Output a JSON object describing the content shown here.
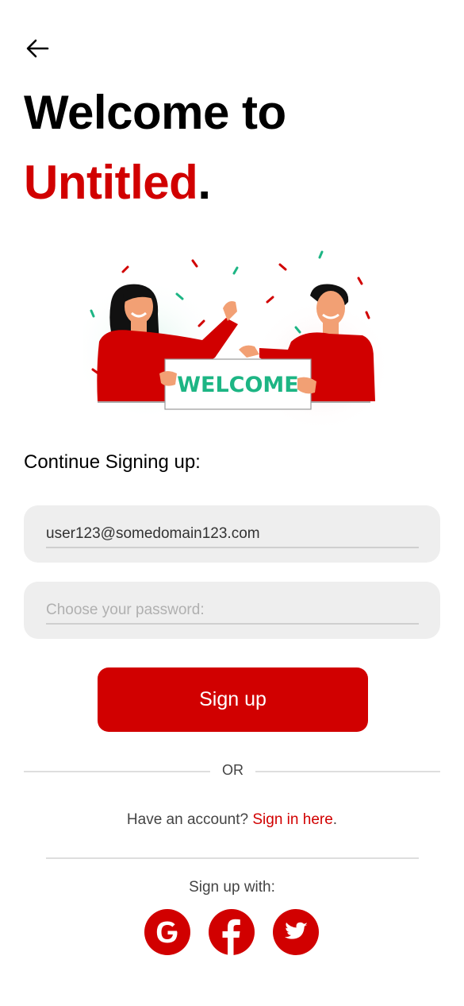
{
  "header": {
    "title_line1": "Welcome to",
    "title_brand": "Untitled",
    "title_period": "."
  },
  "illustration": {
    "sign_text": "WELCOME",
    "icon": "welcome-people-illustration"
  },
  "form": {
    "subtitle": "Continue Signing up:",
    "email_value": "user123@somedomain123.com",
    "password_placeholder": "Choose your password:",
    "signup_label": "Sign up"
  },
  "divider": {
    "or_text": "OR"
  },
  "signin": {
    "prompt": "Have an account? ",
    "link": "Sign in here",
    "suffix": "."
  },
  "social": {
    "label": "Sign up with:",
    "providers": [
      "google",
      "facebook",
      "twitter"
    ]
  },
  "colors": {
    "accent": "#d10000",
    "field_bg": "#eeeeee",
    "illustration_green": "#1db584"
  }
}
